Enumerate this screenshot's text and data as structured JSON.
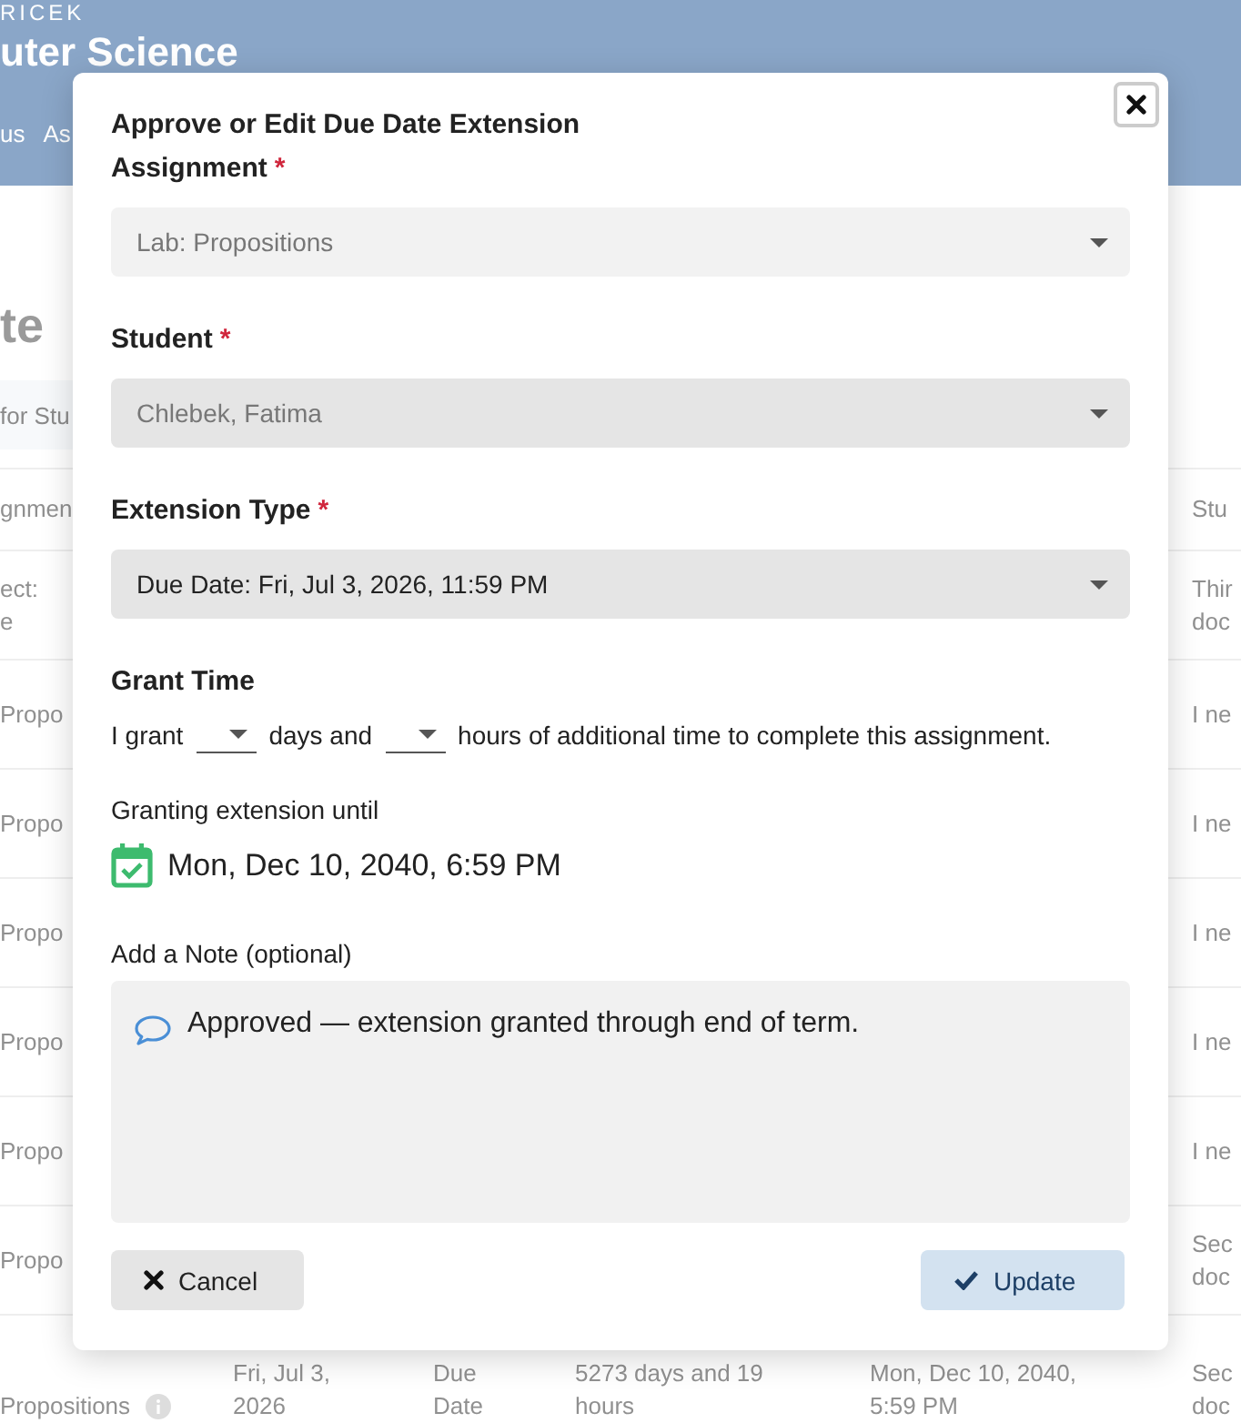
{
  "background": {
    "brand": "RICEK",
    "course_title": "uter Science",
    "nav": [
      "us",
      "As"
    ],
    "heading": "te",
    "search": {
      "placeholder": "for Stu"
    },
    "table": {
      "header": {
        "column_1": [
          "gnmen"
        ],
        "column_6": [
          "Stu"
        ]
      },
      "rows": [
        {
          "column_1": [
            "ect:",
            "e"
          ],
          "column_6": [
            "Thir",
            "doc"
          ]
        },
        {
          "column_1": [
            "Propo"
          ],
          "column_6": [
            "I ne"
          ]
        },
        {
          "column_1": [
            "Propo"
          ],
          "column_6": [
            "I ne"
          ]
        },
        {
          "column_1": [
            "Propo"
          ],
          "column_6": [
            "I ne"
          ]
        },
        {
          "column_1": [
            "Propo"
          ],
          "column_6": [
            "I ne"
          ]
        },
        {
          "column_1": [
            "Propo"
          ],
          "column_6": [
            "I ne"
          ]
        },
        {
          "column_1": [
            "Propo"
          ],
          "column_6": [
            "Sec",
            "doc"
          ]
        },
        {
          "column_1": [
            "Propositions"
          ],
          "info_icon": true,
          "column_2": [
            "Fri, Jul 3,",
            "2026"
          ],
          "column_3": [
            "Due",
            "Date"
          ],
          "column_4": [
            "5273 days and 19",
            "hours"
          ],
          "column_5": [
            "Mon, Dec 10, 2040,",
            "5:59 PM"
          ],
          "column_6": [
            "Sec",
            "doc"
          ]
        }
      ]
    }
  },
  "dialog": {
    "title": "Approve or Edit Due Date Extension",
    "fields": [
      {
        "label": "Assignment",
        "required_mark": "*",
        "value": "Lab: Propositions",
        "disabled": true,
        "kind": "light"
      },
      {
        "label": "Student",
        "required_mark": "*",
        "value": "Chlebek, Fatima",
        "disabled": true,
        "kind": "dark"
      },
      {
        "label": "Extension Type",
        "required_mark": "*",
        "value": "Due Date: Fri, Jul 3, 2026, 11:59 PM",
        "disabled": false,
        "kind": "dark"
      }
    ],
    "grant_time": {
      "label": "Grant Time",
      "segments": [
        {
          "kind": "text",
          "text": "I grant"
        },
        {
          "kind": "select"
        },
        {
          "kind": "text",
          "text": "days and"
        },
        {
          "kind": "select"
        },
        {
          "kind": "text",
          "text": "hours of additional time to complete this assignment."
        }
      ]
    },
    "until": {
      "label": "Granting extension until",
      "value": "Mon, Dec 10, 2040, 6:59 PM"
    },
    "note": {
      "label": "Add a Note (optional)",
      "value": "Approved — extension granted through end of term."
    },
    "buttons": [
      {
        "kind": "cancel",
        "label": "Cancel"
      },
      {
        "kind": "update",
        "label": "Update"
      }
    ]
  }
}
